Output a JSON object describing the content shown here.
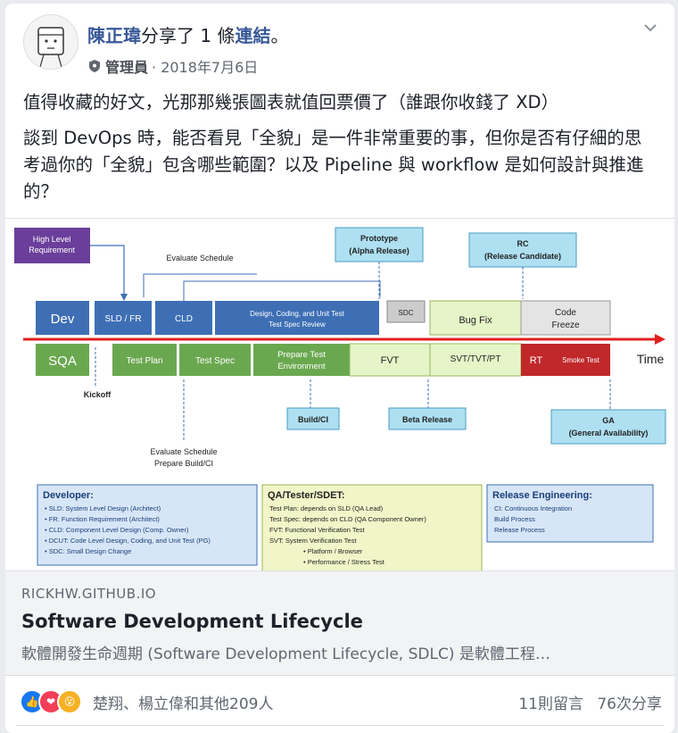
{
  "post": {
    "author": "陳正瑋",
    "action_pre": "分享了 1 條",
    "action_link": "連結",
    "action_post": "。",
    "role": "管理員",
    "date": "· 2018年7月6日",
    "text1": "值得收藏的好文，光那那幾張圖表就值回票價了（誰跟你收錢了 XD）",
    "text2": "談到 DevOps 時，能否看見「全貌」是一件非常重要的事，但你是否有仔細的思考過你的「全貌」包含哪些範圍？以及 Pipeline 與 workflow 是如何設計與推進的？"
  },
  "link_preview": {
    "domain": "RICKHW.GITHUB.IO",
    "title": "Software Development Lifecycle",
    "description": "軟體開發生命週期 (Software Development Lifecycle, SDLC) 是軟體工程…"
  },
  "footer": {
    "reaction_names": "楚翔、楊立偉和其他209人",
    "comments": "11則留言",
    "shares": "76次分享"
  },
  "diagram": {
    "high_level_req": [
      "High Level",
      "Requirement"
    ],
    "evaluate_schedule": "Evaluate Schedule",
    "prototype": [
      "Prototype",
      "(Alpha Release)"
    ],
    "rc": [
      "RC",
      "(Release Candidate)"
    ],
    "dev": "Dev",
    "sld_fr": "SLD / FR",
    "cld": "CLD",
    "design_coding": [
      "Design, Coding, and Unit Test",
      "Test Spec Review"
    ],
    "sdc": "SDC",
    "bug_fix": "Bug Fix",
    "code_freeze": [
      "Code",
      "Freeze"
    ],
    "sqa": "SQA",
    "test_plan": "Test Plan",
    "test_spec": "Test Spec",
    "prepare_test": [
      "Prepare Test",
      "Environment"
    ],
    "fvt": "FVT",
    "svt": "SVT/TVT/PT",
    "rt": "RT",
    "smoke_test": "Smoke Test",
    "time": "Time",
    "kickoff": "Kickoff",
    "build_ci": "Build/CI",
    "beta_release": "Beta Release",
    "ga": [
      "GA",
      "(General Availability)"
    ],
    "evaluate_prepare": [
      "Evaluate Schedule",
      "Prepare Build/CI"
    ],
    "developer_title": "Developer:",
    "developer_items": [
      "• SLD: System Level Design (Architect)",
      "• FR: Function Requirement (Architect)",
      "• CLD: Component Level Design (Comp. Owner)",
      "• DCUT: Code Level Design, Coding, and Unit Test (PG)",
      "• SDC: Small Design Change"
    ],
    "qa_title": "QA/Tester/SDET:",
    "qa_items": [
      "Test Plan: depends on SLD  (QA Lead)",
      "Test Spec: depends on CLD  (QA Component Owner)",
      "FVT: Functional Verification Test",
      "SVT: System Verification Test",
      "• Platform / Browser",
      "• Performance / Stress Test"
    ],
    "re_title": "Release Engineering:",
    "re_items": [
      "CI: Continuous Integration",
      "Build Process",
      "Release Process"
    ]
  },
  "colors": {
    "link_blue": "#385898",
    "like_blue": "#1877f2",
    "dev_blue": "#3e6fb5",
    "sqa_green": "#6aa84f",
    "timeline_red": "#e02020"
  }
}
